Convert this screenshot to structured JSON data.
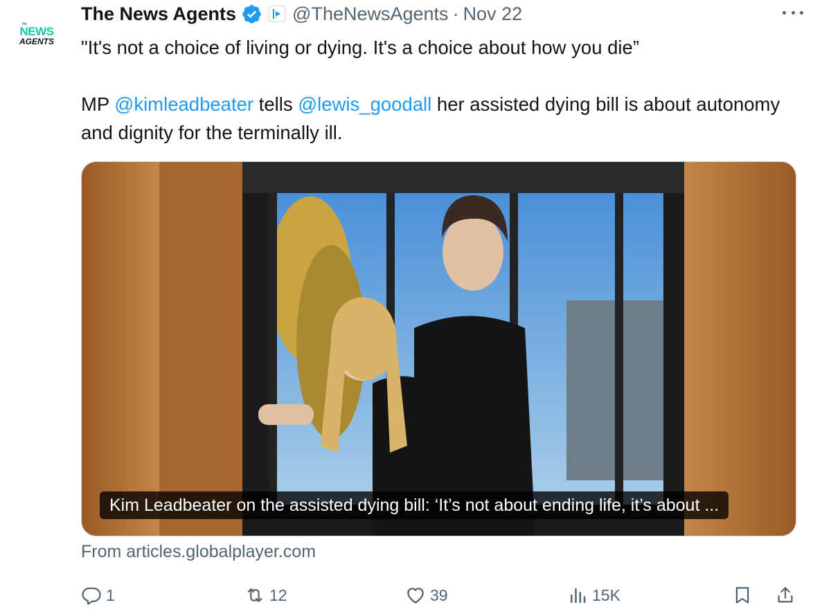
{
  "tweet": {
    "avatar": {
      "tiny": "the",
      "news": "NEWS",
      "agents": "AGENTS"
    },
    "display_name": "The News Agents",
    "handle": "@TheNewsAgents",
    "separator": "·",
    "date": "Nov 22",
    "text_line1": "\"It's not a choice of living or dying. It's a choice about how you die”",
    "text_line2": {
      "p1": "MP ",
      "mention1": "@kimleadbeater",
      "p2": " tells ",
      "mention2": "@lewis_goodall",
      "p3": " her assisted dying bill is about autonomy and dignity for the terminally ill."
    },
    "media_caption": "Kim Leadbeater on the assisted dying bill: ‘It’s not about ending life, it’s about ...",
    "source": "From articles.globalplayer.com",
    "stats": {
      "replies": "1",
      "reposts": "12",
      "likes": "39",
      "views": "15K"
    }
  },
  "colors": {
    "accent": "#1d9bf0",
    "muted": "#536471",
    "brand": "#19c7a8",
    "text": "#0f1419"
  },
  "icons": [
    "verified-badge-icon",
    "affiliate-badge-icon",
    "more-icon",
    "reply-icon",
    "repost-icon",
    "like-icon",
    "views-icon",
    "bookmark-icon",
    "share-icon"
  ]
}
